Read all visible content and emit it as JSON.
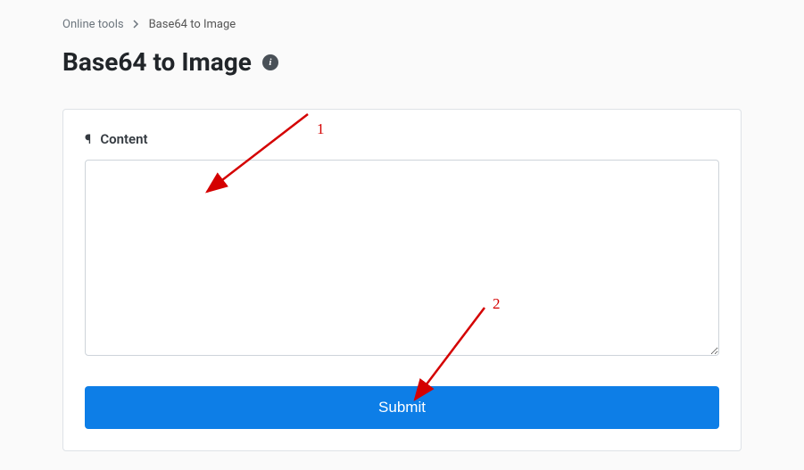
{
  "breadcrumb": {
    "root": "Online tools",
    "current": "Base64 to Image"
  },
  "header": {
    "title": "Base64 to Image"
  },
  "form": {
    "content_label": "Content",
    "content_value": "",
    "submit_label": "Submit"
  },
  "annotations": {
    "label1": "1",
    "label2": "2"
  }
}
